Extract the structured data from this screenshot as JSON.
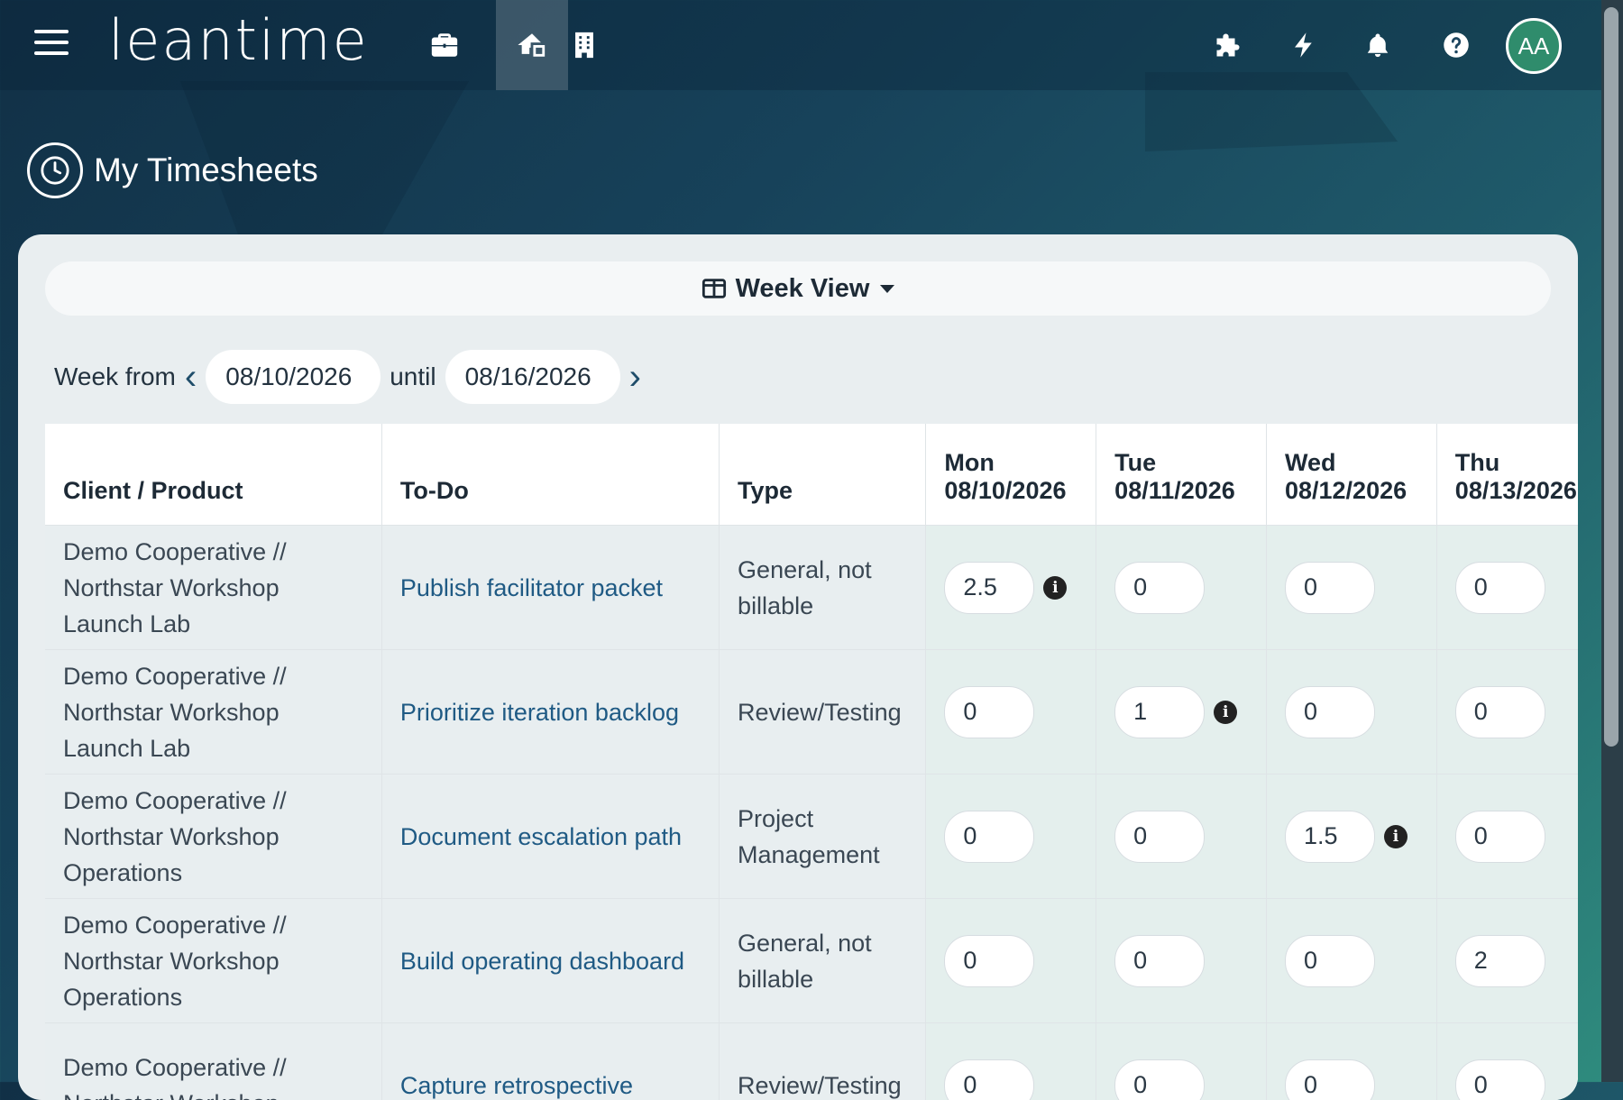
{
  "app": {
    "logo": "leantime"
  },
  "nav": {
    "icons": [
      "briefcase-icon",
      "home-icon",
      "building-icon"
    ],
    "right_icons": [
      "puzzle-icon",
      "lightning-icon",
      "bell-icon",
      "help-icon"
    ],
    "avatar_initials": "AA"
  },
  "page": {
    "title": "My Timesheets"
  },
  "view": {
    "label": "Week View"
  },
  "week": {
    "from_label": "Week from",
    "from": "08/10/2026",
    "until_label": "until",
    "until": "08/16/2026"
  },
  "table": {
    "headers": {
      "client": "Client / Product",
      "todo": "To-Do",
      "type": "Type",
      "days": [
        {
          "day": "Mon",
          "date": "08/10/2026"
        },
        {
          "day": "Tue",
          "date": "08/11/2026"
        },
        {
          "day": "Wed",
          "date": "08/12/2026"
        },
        {
          "day": "Thu",
          "date": "08/13/2026"
        }
      ]
    },
    "rows": [
      {
        "client": "Demo Cooperative // Northstar Workshop Launch Lab",
        "todo": "Publish facilitator packet",
        "type": "General, not billable",
        "hours": [
          "2.5",
          "0",
          "0",
          "0"
        ]
      },
      {
        "client": "Demo Cooperative // Northstar Workshop Launch Lab",
        "todo": "Prioritize iteration backlog",
        "type": "Review/Testing",
        "hours": [
          "0",
          "1",
          "0",
          "0"
        ]
      },
      {
        "client": "Demo Cooperative // Northstar Workshop Operations",
        "todo": "Document escalation path",
        "type": "Project Management",
        "hours": [
          "0",
          "0",
          "1.5",
          "0"
        ]
      },
      {
        "client": "Demo Cooperative // Northstar Workshop Operations",
        "todo": "Build operating dashboard",
        "type": "General, not billable",
        "hours": [
          "0",
          "0",
          "0",
          "2"
        ]
      },
      {
        "client": "Demo Cooperative // Northstar Workshop",
        "todo": "Capture retrospective",
        "type": "Review/Testing",
        "hours": [
          "0",
          "0",
          "0",
          "0"
        ]
      }
    ]
  }
}
